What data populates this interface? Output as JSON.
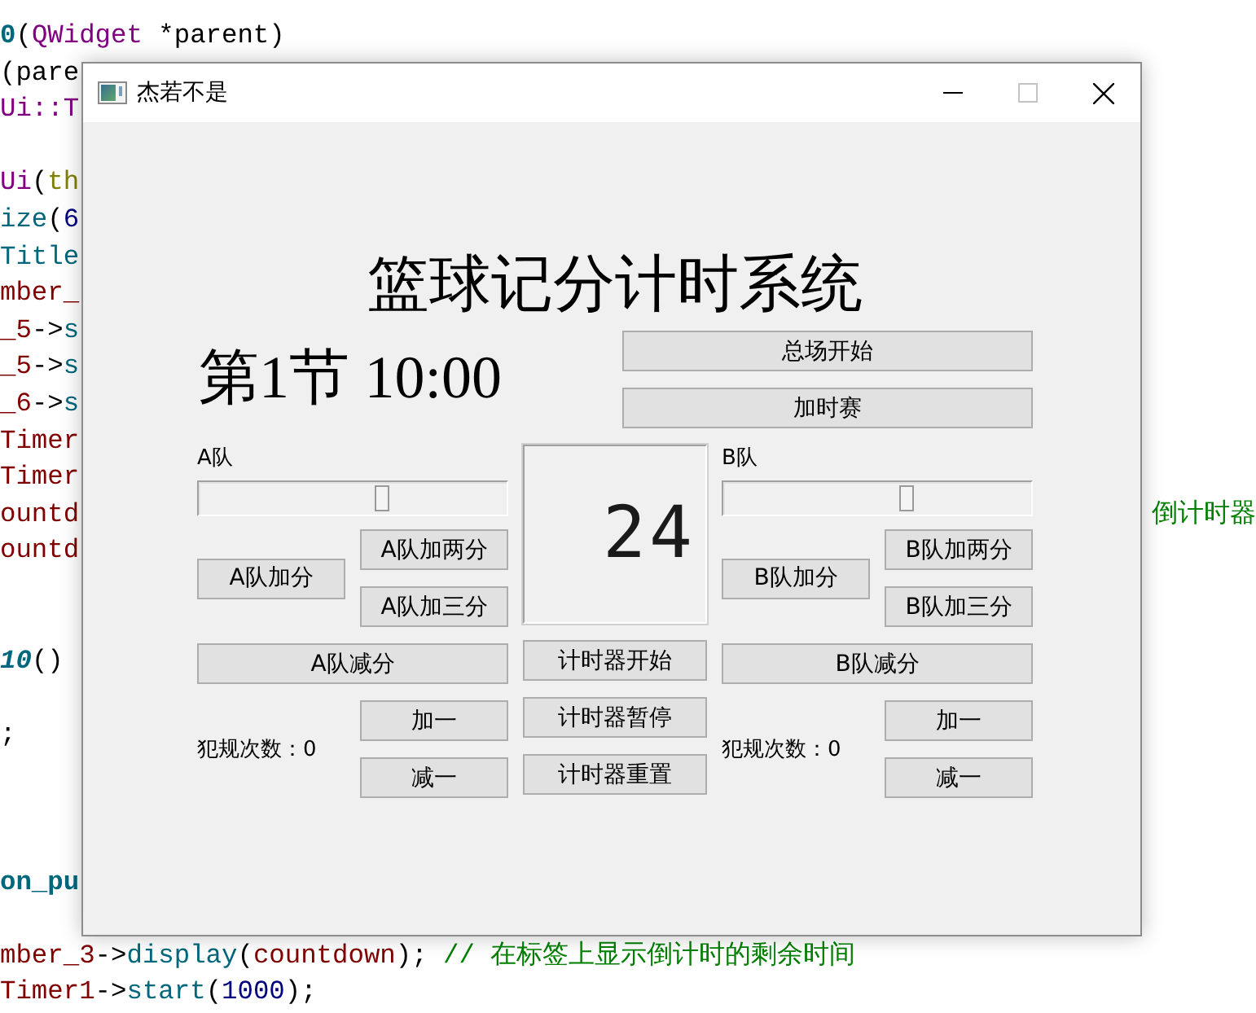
{
  "code_editor": {
    "blocks": [
      {
        "lines": [
          {
            "segments": [
              {
                "text": "0",
                "kind": "function_bold"
              },
              {
                "text": "(",
                "kind": "plain"
              },
              {
                "text": "QWidget",
                "kind": "type"
              },
              {
                "text": " *parent)",
                "kind": "plain"
              }
            ]
          },
          {
            "segments": [
              {
                "text": "(pare",
                "kind": "plain"
              }
            ]
          },
          {
            "segments": [
              {
                "text": "Ui::T",
                "kind": "type"
              }
            ]
          }
        ]
      },
      {
        "lines": [
          {
            "segments": [
              {
                "text": "Ui",
                "kind": "type"
              },
              {
                "text": "(",
                "kind": "plain"
              },
              {
                "text": "th",
                "kind": "keyword"
              }
            ]
          },
          {
            "segments": [
              {
                "text": "ize",
                "kind": "function"
              },
              {
                "text": "(",
                "kind": "plain"
              },
              {
                "text": "6",
                "kind": "number"
              }
            ]
          },
          {
            "segments": [
              {
                "text": "Title",
                "kind": "function"
              }
            ]
          },
          {
            "segments": [
              {
                "text": "mber_",
                "kind": "member"
              }
            ]
          },
          {
            "segments": [
              {
                "text": "_5",
                "kind": "member"
              },
              {
                "text": "->",
                "kind": "plain"
              },
              {
                "text": "s",
                "kind": "function"
              }
            ]
          },
          {
            "segments": [
              {
                "text": "_5",
                "kind": "member"
              },
              {
                "text": "->",
                "kind": "plain"
              },
              {
                "text": "s",
                "kind": "function"
              }
            ]
          },
          {
            "segments": [
              {
                "text": "_6",
                "kind": "member"
              },
              {
                "text": "->",
                "kind": "plain"
              },
              {
                "text": "s",
                "kind": "function"
              }
            ]
          },
          {
            "segments": [
              {
                "text": "Timer",
                "kind": "member"
              }
            ]
          },
          {
            "segments": [
              {
                "text": "Timer",
                "kind": "member"
              }
            ]
          },
          {
            "segments": [
              {
                "text": "ountd",
                "kind": "member"
              }
            ],
            "right": [
              {
                "text": "倒计时器",
                "kind": "comment"
              }
            ]
          },
          {
            "segments": [
              {
                "text": "ountd",
                "kind": "member"
              }
            ]
          }
        ]
      },
      {
        "lines": [
          {
            "segments": [
              {
                "text": "10",
                "kind": "function_bold_italic"
              },
              {
                "text": "()",
                "kind": "plain"
              }
            ]
          }
        ]
      },
      {
        "lines": [
          {
            "segments": [
              {
                "text": ";",
                "kind": "plain"
              }
            ]
          }
        ]
      },
      {
        "lines": [
          {
            "segments": [
              {
                "text": "on_pu",
                "kind": "function_bold"
              }
            ]
          }
        ]
      },
      {
        "lines": [
          {
            "segments": [
              {
                "text": "mber_3",
                "kind": "member"
              },
              {
                "text": "->",
                "kind": "plain"
              },
              {
                "text": "display",
                "kind": "function"
              },
              {
                "text": "(",
                "kind": "plain"
              },
              {
                "text": "countdown",
                "kind": "member"
              },
              {
                "text": "); ",
                "kind": "plain"
              },
              {
                "text": "// 在标签上显示倒计时的剩余时间",
                "kind": "comment"
              }
            ]
          },
          {
            "segments": [
              {
                "text": "Timer1",
                "kind": "member"
              },
              {
                "text": "->",
                "kind": "plain"
              },
              {
                "text": "start",
                "kind": "function"
              },
              {
                "text": "(",
                "kind": "plain"
              },
              {
                "text": "1000",
                "kind": "number"
              },
              {
                "text": ");",
                "kind": "plain"
              }
            ]
          }
        ]
      }
    ]
  },
  "window": {
    "title": "杰若不是",
    "maximize_disabled": true,
    "heading": "篮球记分计时系统",
    "period_clock": "第1节 10:00",
    "game_buttons": [
      "总场开始",
      "加时赛"
    ],
    "teams": [
      {
        "name": "A队",
        "slider": {
          "level": 0.6
        },
        "add_button": "A队加分",
        "add_two_button": "A队加两分",
        "add_three_button": "A队加三分",
        "subtract_button": "A队减分",
        "fouls": "犯规次数：0",
        "foul_add_button": "加一",
        "foul_subtract_button": "减一"
      },
      {
        "name": "B队",
        "slider": {
          "level": 0.6
        },
        "add_button": "B队加分",
        "add_two_button": "B队加两分",
        "add_three_button": "B队加三分",
        "subtract_button": "B队减分",
        "fouls": "犯规次数：0",
        "foul_add_button": "加一",
        "foul_subtract_button": "减一"
      }
    ],
    "shot_clock": {
      "display": "24",
      "buttons": [
        "计时器开始",
        "计时器暂停",
        "计时器重置"
      ]
    }
  }
}
